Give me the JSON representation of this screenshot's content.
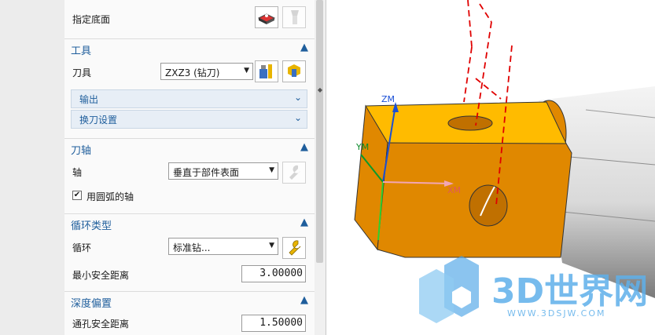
{
  "panel": {
    "specify_bottom_label": "指定底面",
    "tool_section": {
      "title": "工具",
      "tool_label": "刀具",
      "tool_value": "ZXZ3 (钻刀)",
      "output_label": "输出",
      "tool_change_label": "换刀设置"
    },
    "axis_section": {
      "title": "刀轴",
      "axis_label": "轴",
      "axis_value": "垂直于部件表面",
      "use_arc_axis_label": "用圆弧的轴",
      "use_arc_axis_checked": true
    },
    "cycle_section": {
      "title": "循环类型",
      "cycle_label": "循环",
      "cycle_value": "标准钻...",
      "min_clearance_label": "最小安全距离",
      "min_clearance_value": "3.00000"
    },
    "depth_section": {
      "title": "深度偏置",
      "through_clearance_label": "通孔安全距离",
      "through_clearance_value": "1.50000"
    }
  },
  "viewport": {
    "axis_x": "XM",
    "axis_y": "YM",
    "axis_z": "ZM",
    "watermark_title": "3D世界网",
    "watermark_url": "WWW.3DSJW.COM"
  },
  "colors": {
    "section_title": "#1f5e9c",
    "part_top": "#ffbb00",
    "part_front": "#e08800",
    "toolpath": "#e00000"
  }
}
